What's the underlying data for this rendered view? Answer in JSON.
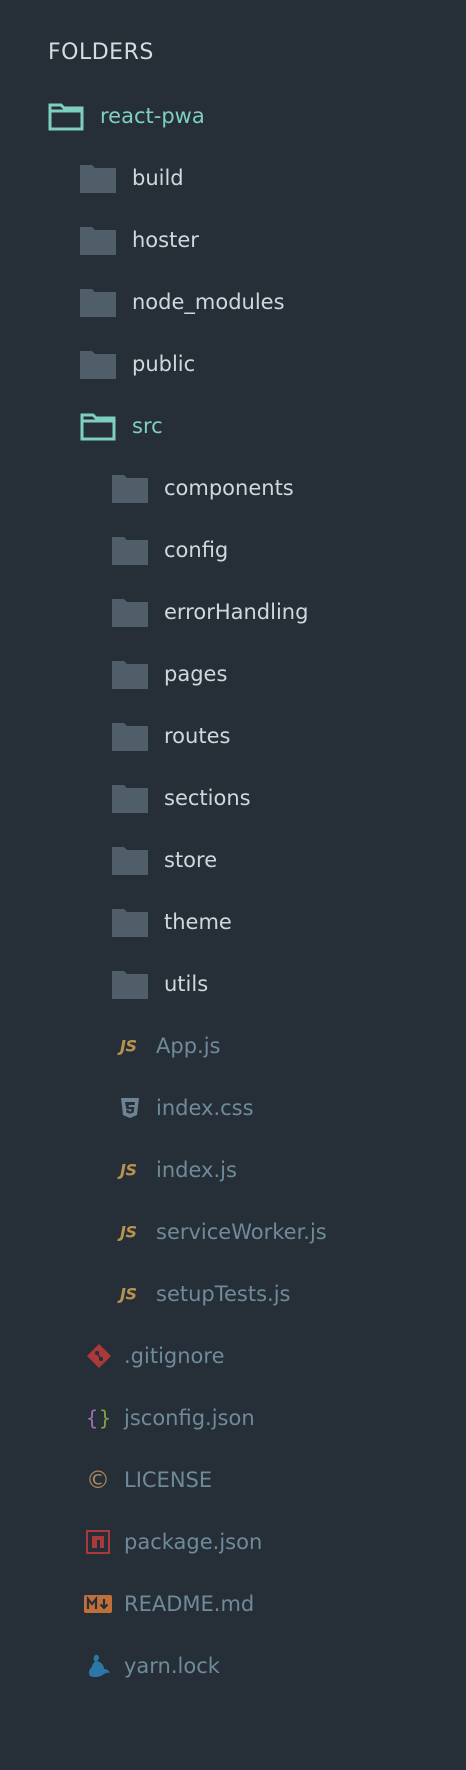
{
  "header": {
    "title": "FOLDERS"
  },
  "colors": {
    "background": "#262f37",
    "folder_icon": "#4f5e68",
    "open_folder": "#7ecfc2",
    "folder_label": "#d1d7dc",
    "file_label": "#6f8a99",
    "js_icon": "#b8924f",
    "git_icon": "#a9393b",
    "npm_icon": "#a9393b",
    "markdown_icon": "#c06f3b",
    "yarn_icon": "#2b78a8"
  },
  "tree": {
    "root": {
      "label": "react-pwa",
      "icon": "folder-open-icon"
    },
    "folders_level1": {
      "build": "build",
      "hoster": "hoster",
      "node_modules": "node_modules",
      "public": "public",
      "src": "src"
    },
    "src_folders": {
      "components": "components",
      "config": "config",
      "errorHandling": "errorHandling",
      "pages": "pages",
      "routes": "routes",
      "sections": "sections",
      "store": "store",
      "theme": "theme",
      "utils": "utils"
    },
    "src_files": {
      "app_js": "App.js",
      "index_css": "index.css",
      "index_js": "index.js",
      "service_worker": "serviceWorker.js",
      "setup_tests": "setupTests.js"
    },
    "root_files": {
      "gitignore": ".gitignore",
      "jsconfig": "jsconfig.json",
      "license": "LICENSE",
      "package": "package.json",
      "readme": "README.md",
      "yarn": "yarn.lock"
    },
    "icon_glyphs": {
      "js": "JS",
      "license": "©",
      "braces": "{ }"
    }
  }
}
